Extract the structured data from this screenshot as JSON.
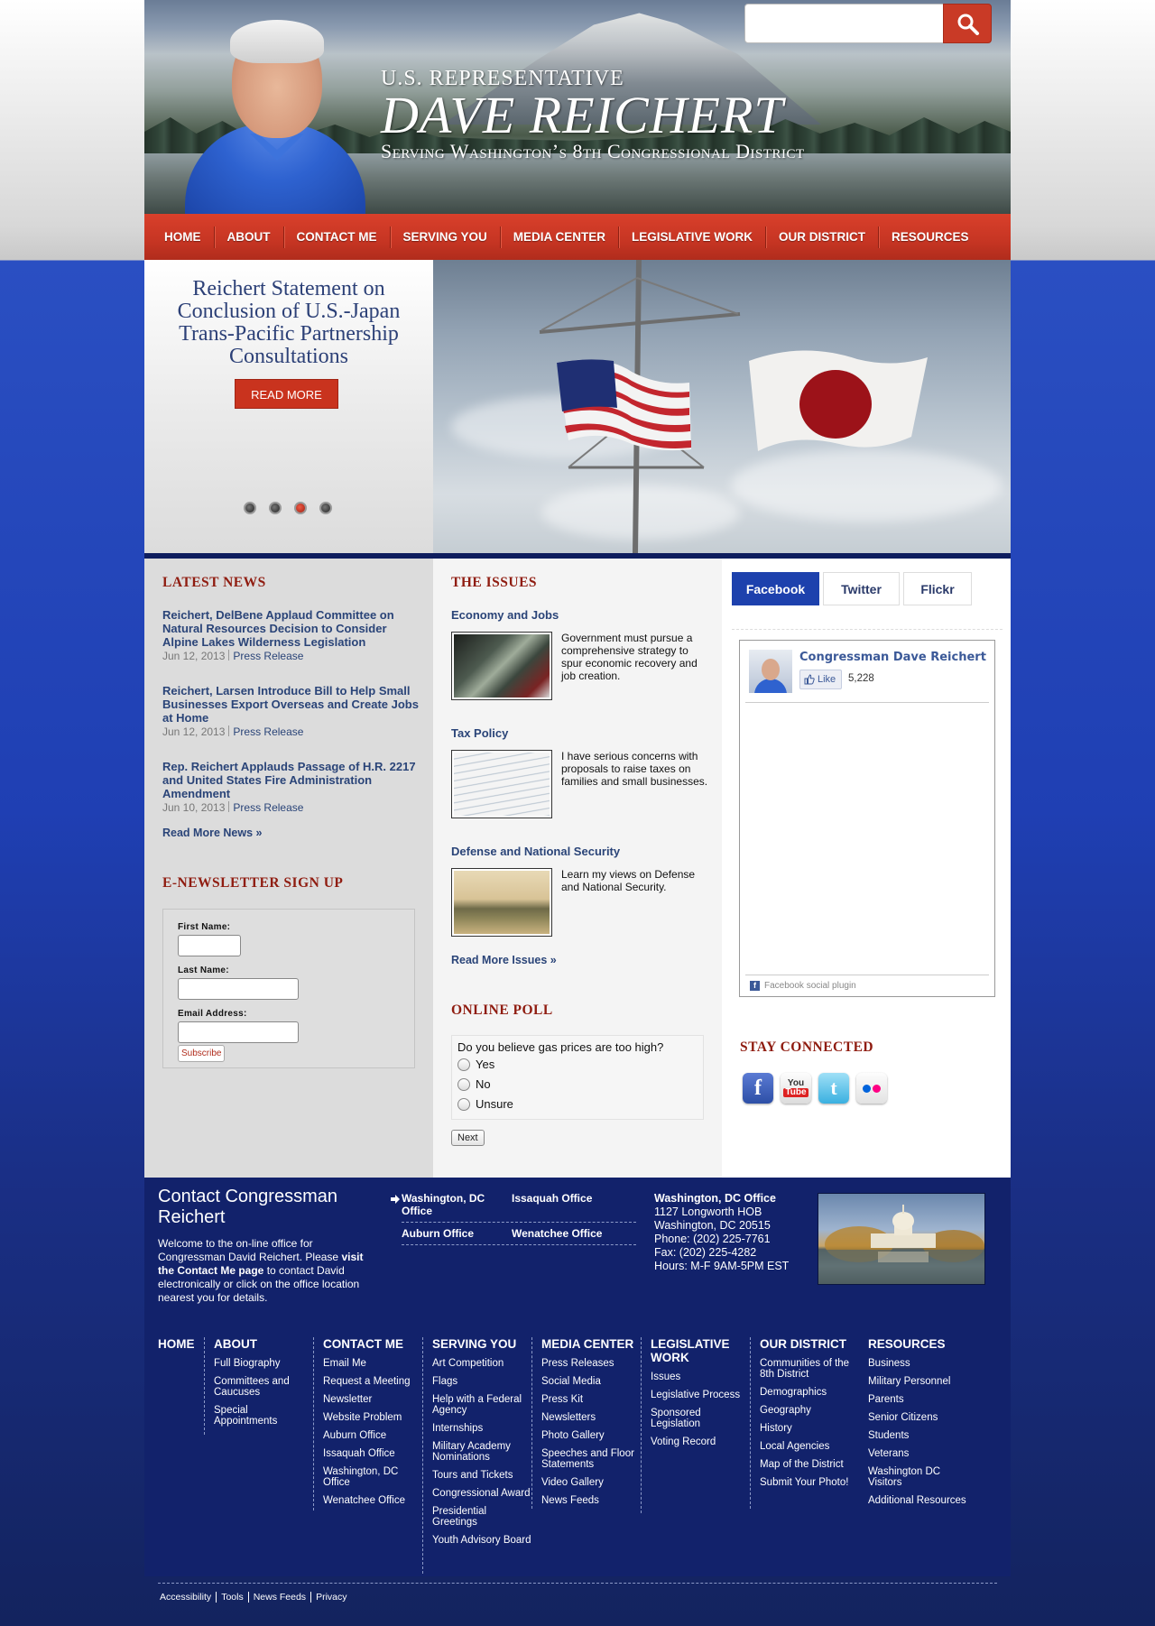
{
  "header": {
    "rep_line": "U.S. REPRESENTATIVE",
    "name": "DAVE REICHERT",
    "subtitle": "Serving Washington’s 8th Congressional District",
    "search_placeholder": ""
  },
  "nav": [
    "HOME",
    "ABOUT",
    "CONTACT ME",
    "SERVING YOU",
    "MEDIA CENTER",
    "LEGISLATIVE WORK",
    "OUR DISTRICT",
    "RESOURCES"
  ],
  "hero": {
    "headline": "Reichert Statement on Conclusion of U.S.-Japan Trans-Pacific Partnership Consultations",
    "button": "READ MORE",
    "slides": 4,
    "active_slide": 3
  },
  "latest_news": {
    "title": "LATEST NEWS",
    "items": [
      {
        "title": "Reichert, DelBene Applaud Committee on Natural Resources Decision to Consider Alpine Lakes Wilderness Legislation",
        "date": "Jun 12, 2013",
        "type": "Press Release"
      },
      {
        "title": "Reichert, Larsen Introduce Bill to Help Small Businesses Export Overseas and Create Jobs at Home",
        "date": "Jun 12, 2013",
        "type": "Press Release"
      },
      {
        "title": "Rep. Reichert Applauds Passage of H.R. 2217 and United States Fire Administration Amendment",
        "date": "Jun 10, 2013",
        "type": "Press Release"
      }
    ],
    "more": "Read More News »"
  },
  "newsletter": {
    "title": "E-NEWSLETTER SIGN UP",
    "first_name": "First Name:",
    "last_name": "Last Name:",
    "email": "Email Address:",
    "submit": "Subscribe"
  },
  "issues": {
    "title": "THE ISSUES",
    "items": [
      {
        "title": "Economy and Jobs",
        "text": "Government must pursue a comprehensive strategy to spur economic recovery and job creation."
      },
      {
        "title": "Tax Policy",
        "text": "I have serious concerns with proposals to raise taxes on families and small businesses."
      },
      {
        "title": "Defense and National Security",
        "text": "Learn my views on Defense and National Security."
      }
    ],
    "more": "Read More Issues »"
  },
  "poll": {
    "title": "ONLINE POLL",
    "question": "Do you believe gas prices are too high?",
    "options": [
      "Yes",
      "No",
      "Unsure"
    ],
    "next": "Next"
  },
  "social_tabs": {
    "tabs": [
      "Facebook",
      "Twitter",
      "Flickr"
    ],
    "active": "Facebook",
    "fb_page": "Congressman Dave Reichert",
    "like_label": "Like",
    "like_count": "5,228",
    "plugin_label": "Facebook social plugin"
  },
  "stay_connected": {
    "title": "STAY CONNECTED",
    "icons": [
      "facebook-icon",
      "youtube-icon",
      "twitter-icon",
      "flickr-icon"
    ]
  },
  "contact": {
    "title": "Contact Congressman Reichert",
    "desc_pre": "Welcome to the on-line office for Congressman David Reichert. Please ",
    "desc_link": "visit the Contact Me page",
    "desc_post": " to contact David electronically or click on the office location nearest you for details.",
    "offices": [
      "Washington, DC Office",
      "Issaquah Office",
      "Auburn Office",
      "Wenatchee Office"
    ],
    "address": {
      "name": "Washington, DC Office",
      "line1": "1127 Longworth HOB",
      "line2": "Washington, DC 20515",
      "phone": "Phone: (202) 225-7761",
      "fax": "Fax: (202) 225-4282",
      "hours": "Hours: M-F 9AM-5PM EST"
    }
  },
  "footer_nav": [
    {
      "heading": "HOME",
      "links": []
    },
    {
      "heading": "ABOUT",
      "links": [
        "Full Biography",
        "Committees and Caucuses",
        "Special Appointments"
      ]
    },
    {
      "heading": "CONTACT ME",
      "links": [
        "Email Me",
        "Request a Meeting",
        "Newsletter",
        "Website Problem",
        "Auburn Office",
        "Issaquah Office",
        "Washington, DC Office",
        "Wenatchee Office"
      ]
    },
    {
      "heading": "SERVING YOU",
      "links": [
        "Art Competition",
        "Flags",
        "Help with a Federal Agency",
        "Internships",
        "Military Academy Nominations",
        "Tours and Tickets",
        "Congressional Award",
        "Presidential Greetings",
        "Youth Advisory Board"
      ]
    },
    {
      "heading": "MEDIA CENTER",
      "links": [
        "Press Releases",
        "Social Media",
        "Press Kit",
        "Newsletters",
        "Photo Gallery",
        "Speeches and Floor Statements",
        "Video Gallery",
        "News Feeds"
      ]
    },
    {
      "heading": "LEGISLATIVE WORK",
      "links": [
        "Issues",
        "Legislative Process",
        "Sponsored Legislation",
        "Voting Record"
      ]
    },
    {
      "heading": "OUR DISTRICT",
      "links": [
        "Communities of the 8th District",
        "Demographics",
        "Geography",
        "History",
        "Local Agencies",
        "Map of the District",
        "Submit Your Photo!"
      ]
    },
    {
      "heading": "RESOURCES",
      "links": [
        "Business",
        "Military Personnel",
        "Parents",
        "Senior Citizens",
        "Students",
        "Veterans",
        "Washington DC Visitors",
        "Additional Resources"
      ]
    }
  ],
  "utility_links": [
    "Accessibility",
    "Tools",
    "News Feeds",
    "Privacy"
  ],
  "colors": {
    "nav_red": "#c63523",
    "title_red": "#8f1c10",
    "link_blue": "#2a4478",
    "footer_navy": "#12226b",
    "facebook_blue": "#1d41ad"
  }
}
